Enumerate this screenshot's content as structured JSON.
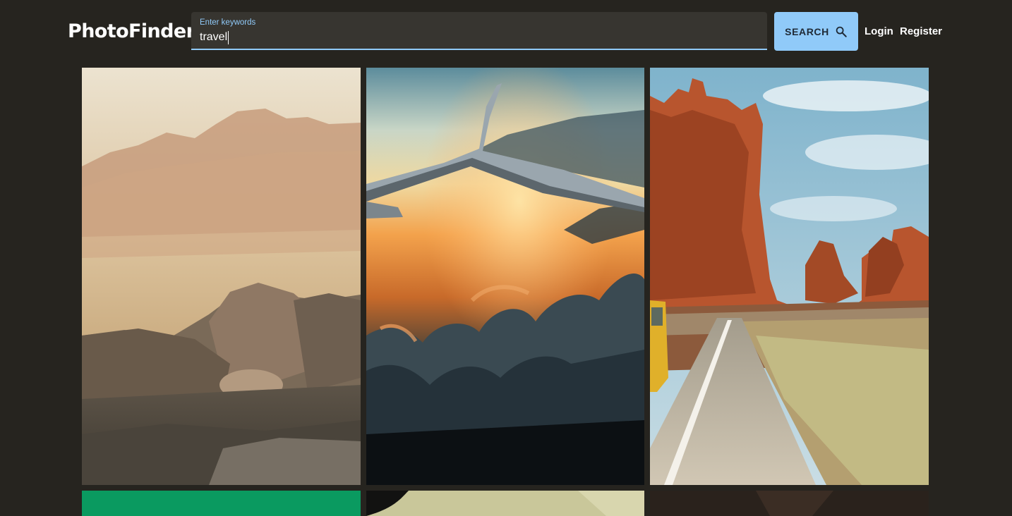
{
  "app": {
    "title": "PhotoFinder"
  },
  "search": {
    "label": "Enter keywords",
    "value": "travel",
    "button_label": "SEARCH",
    "button_icon": "search-icon"
  },
  "nav": {
    "login_label": "Login",
    "register_label": "Register"
  },
  "colors": {
    "background": "#26241f",
    "accent": "#90caf9",
    "field_background": "#373530"
  },
  "gallery": {
    "photos": [
      {
        "subject": "desert-rocks-mountains"
      },
      {
        "subject": "airplane-wing-sunset-clouds"
      },
      {
        "subject": "red-rock-desert-road"
      },
      {
        "subject": "green-photo-partial"
      },
      {
        "subject": "car-window-partial"
      },
      {
        "subject": "dark-photo-partial"
      }
    ]
  }
}
